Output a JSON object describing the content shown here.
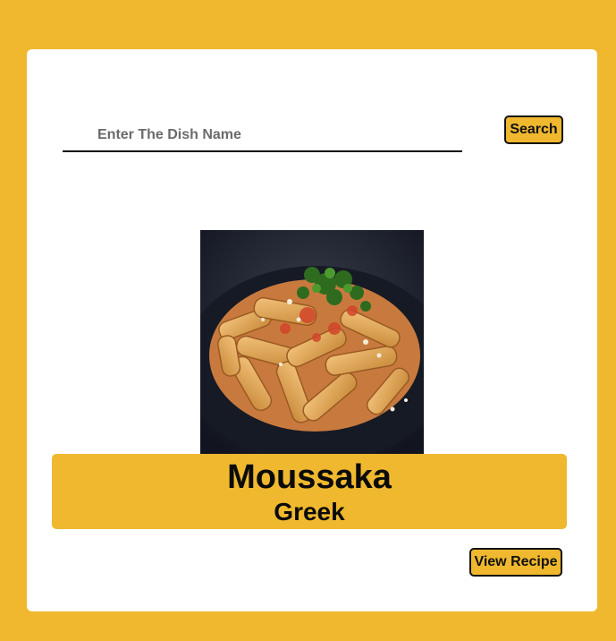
{
  "search": {
    "placeholder": "Enter The Dish Name",
    "value": "",
    "button_label": "Search"
  },
  "meal": {
    "name": "Moussaka",
    "area": "Greek",
    "image_icon": "pasta-photo",
    "view_button_label": "View Recipe"
  },
  "colors": {
    "background": "#EFB82E",
    "card": "#FFFFFF",
    "accent": "#EFB82E",
    "text": "#0B0B0B"
  }
}
